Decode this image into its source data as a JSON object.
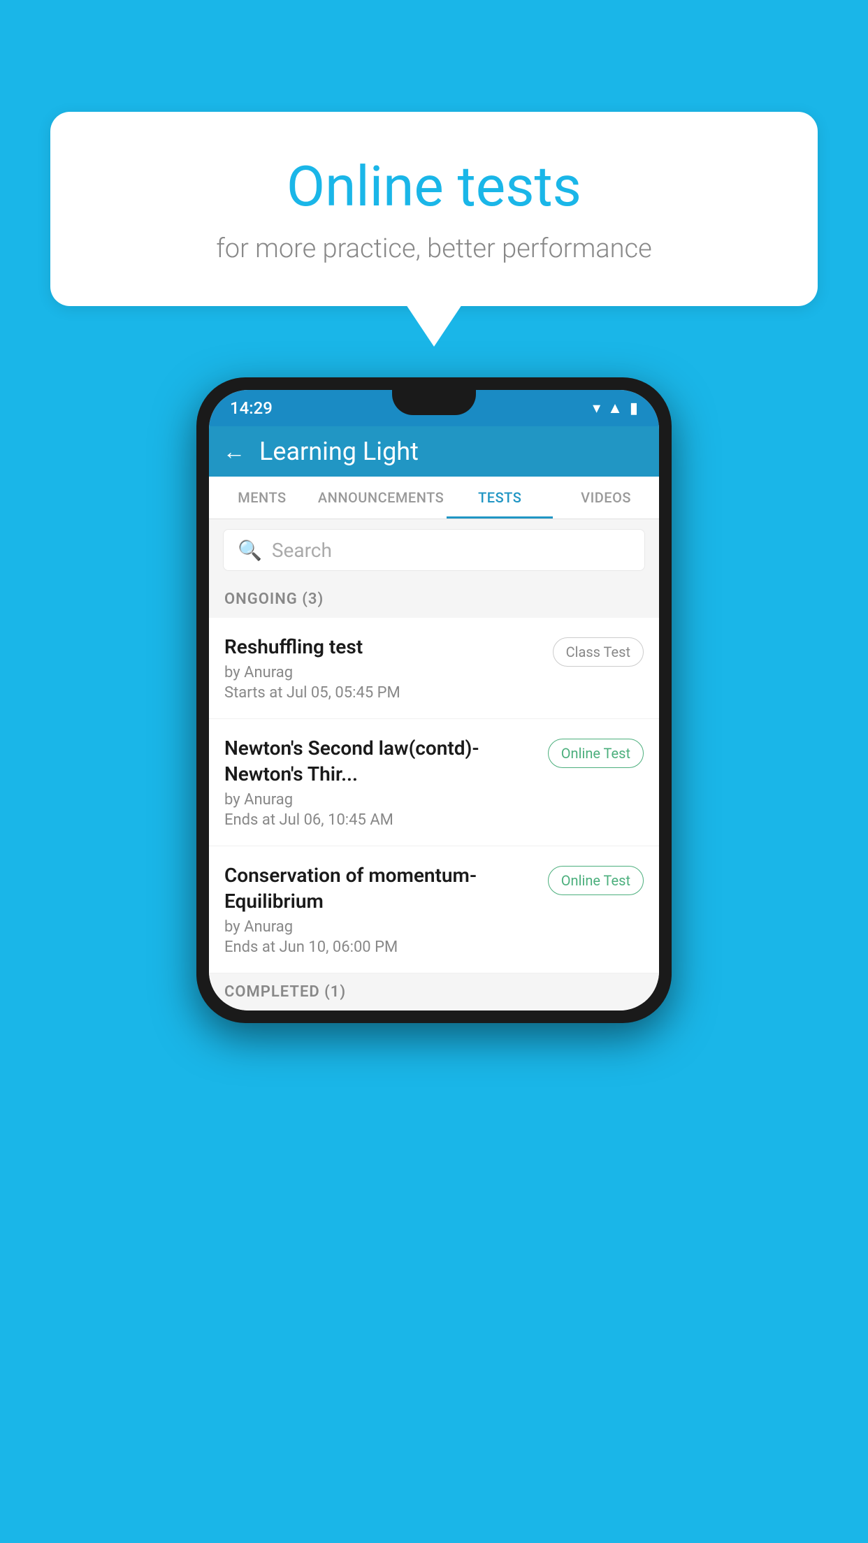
{
  "background_color": "#1ab6e8",
  "speech_bubble": {
    "title": "Online tests",
    "subtitle": "for more practice, better performance"
  },
  "phone": {
    "status_bar": {
      "time": "14:29",
      "icons": [
        "wifi",
        "signal",
        "battery"
      ]
    },
    "app_bar": {
      "title": "Learning Light",
      "back_label": "←"
    },
    "tabs": [
      {
        "label": "MENTS",
        "active": false
      },
      {
        "label": "ANNOUNCEMENTS",
        "active": false
      },
      {
        "label": "TESTS",
        "active": true
      },
      {
        "label": "VIDEOS",
        "active": false
      }
    ],
    "search": {
      "placeholder": "Search"
    },
    "sections": [
      {
        "label": "ONGOING (3)",
        "tests": [
          {
            "name": "Reshuffling test",
            "author": "by Anurag",
            "date": "Starts at  Jul 05, 05:45 PM",
            "badge": "Class Test",
            "badge_type": "class"
          },
          {
            "name": "Newton's Second law(contd)-Newton's Thir...",
            "author": "by Anurag",
            "date": "Ends at  Jul 06, 10:45 AM",
            "badge": "Online Test",
            "badge_type": "online"
          },
          {
            "name": "Conservation of momentum-Equilibrium",
            "author": "by Anurag",
            "date": "Ends at  Jun 10, 06:00 PM",
            "badge": "Online Test",
            "badge_type": "online"
          }
        ]
      }
    ],
    "completed_label": "COMPLETED (1)"
  }
}
